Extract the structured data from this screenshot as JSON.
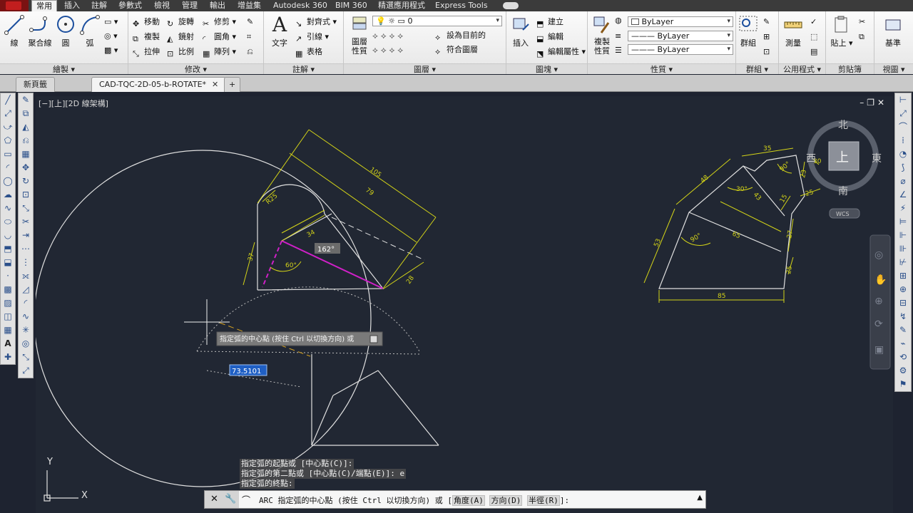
{
  "ribbon_tabs": [
    "常用",
    "插入",
    "註解",
    "參數式",
    "檢視",
    "管理",
    "輸出",
    "增益集",
    "Autodesk 360",
    "BIM 360",
    "精選應用程式",
    "Express Tools"
  ],
  "panels": {
    "draw": {
      "title": "繪製 ▾",
      "line": "線",
      "polyline": "聚合線",
      "circle": "圓",
      "arc": "弧"
    },
    "modify": {
      "title": "修改 ▾",
      "move": "移動",
      "rotate": "旋轉",
      "trim": "修剪",
      "copy": "複製",
      "mirror": "鏡射",
      "fillet": "圓角",
      "stretch": "拉伸",
      "scale": "比例",
      "array": "陣列"
    },
    "annotation": {
      "title": "註解 ▾",
      "text": "文字",
      "dimension": "對齊式",
      "leader": "引線",
      "table": "表格"
    },
    "layers": {
      "title": "圖層 ▾",
      "layer_props": "圖層\n性質",
      "current_layer": "0",
      "set_current": "設為目前的",
      "match_layer": "符合圖層"
    },
    "block": {
      "title": "圖塊 ▾",
      "insert": "插入",
      "create": "建立",
      "edit": "編輯",
      "edit_attr": "編輯屬性"
    },
    "properties": {
      "title": "性質 ▾",
      "match": "複製\n性質",
      "color": "ByLayer",
      "linetype": "ByLayer",
      "lineweight": "ByLayer"
    },
    "groups": {
      "title": "群組 ▾",
      "group": "群組"
    },
    "utilities": {
      "title": "公用程式 ▾",
      "measure": "測量"
    },
    "clipboard": {
      "title": "剪貼簿",
      "paste": "貼上"
    },
    "view": {
      "title": "視圖 ▾",
      "base": "基準"
    }
  },
  "doc_tabs": [
    "新頁籤",
    "CAD-TQC-2D-05-b-ROTATE*"
  ],
  "viewport_label": "[−][上][2D 線架構]",
  "viewcube": {
    "north": "北",
    "south": "南",
    "east": "東",
    "west": "西",
    "top": "上",
    "wcs": "WCS"
  },
  "drawing": {
    "dims_left": [
      "105",
      "79",
      "34",
      "37",
      "28",
      "R25",
      "60°"
    ],
    "angle_tip": "162°",
    "tooltip": "指定弧的中心點 (按住 Ctrl 以切換方向) 或",
    "dynamic_input": "73.5101",
    "dims_right": [
      "35",
      "48",
      "43",
      "30°",
      "23",
      "30",
      "25",
      "15",
      "27",
      "25",
      "65",
      "90°",
      "53",
      "85",
      "90°"
    ]
  },
  "ucs": {
    "x": "X",
    "y": "Y"
  },
  "command_history": [
    "指定弧的起點或 [中心點(C)]:",
    "指定弧的第二點或 [中心點(C)/端點(E)]: e",
    "指定弧的終點:"
  ],
  "command_line": {
    "prefix": "ARC 指定弧的中心點 (按住 Ctrl 以切換方向) 或 [",
    "opt1": "角度(A)",
    "opt2": "方向(D)",
    "opt3": "半徑(R)",
    "suffix": "]:"
  },
  "colors": {
    "dim": "#d4d418",
    "geometry": "#e0e0e0",
    "magenta": "#d020c8",
    "canvas": "#212733"
  }
}
